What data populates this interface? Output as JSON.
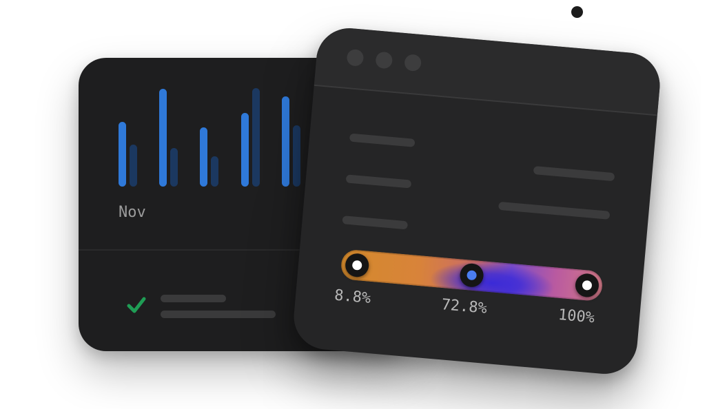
{
  "chart": {
    "month_label": "Nov",
    "colors": {
      "primary": "#2f79d9",
      "secondary": "#1b3860"
    }
  },
  "task": {
    "status_icon": "check-icon",
    "status_color": "#1f9d55"
  },
  "window": {
    "controls": [
      "close",
      "minimize",
      "maximize"
    ]
  },
  "gradient_slider": {
    "stops": [
      {
        "label": "8.8%",
        "value": 8.8
      },
      {
        "label": "72.8%",
        "value": 72.8
      },
      {
        "label": "100%",
        "value": 100
      }
    ],
    "colors": [
      "#d48a2c",
      "#3a2ad8",
      "#d47a88"
    ]
  }
}
